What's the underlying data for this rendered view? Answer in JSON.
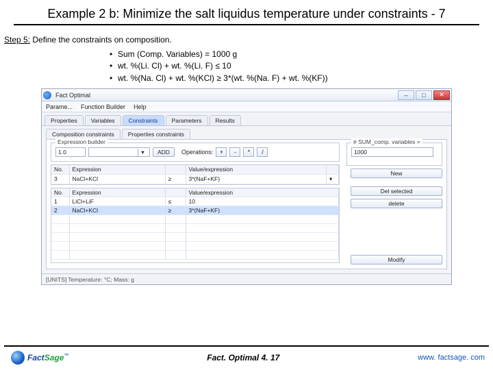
{
  "slide": {
    "title": "Example 2 b: Minimize the salt liquidus temperature under constraints - 7",
    "step_label": "Step 5:",
    "step_text": " Define the constraints on composition.",
    "bullets": [
      "Sum (Comp. Variables) = 1000 g",
      "wt. %(Li. Cl) + wt. %(Li. F) ≤ 10",
      "wt. %(Na. Cl) + wt. %(KCl) ≥ 3*(wt. %(Na. F) + wt. %(KF))"
    ]
  },
  "window": {
    "title": "Fact Optimal",
    "menus": [
      "Parame...",
      "Function Builder",
      "Help"
    ],
    "tabs": [
      "Properties",
      "Variables",
      "Constraints",
      "Parameters",
      "Results"
    ],
    "active_tab": 2,
    "subtabs": [
      "Composition constraints",
      "Properties constraints"
    ],
    "builder": {
      "legend": "Expression builder",
      "left_input": "1.0",
      "add_btn": "ADD",
      "ops_label": "Operations:",
      "ops": [
        "+",
        "-",
        "*",
        "/"
      ],
      "sum_label": "# SUM_comp. variables =",
      "sum_value": "1000"
    },
    "grid1": {
      "headers": [
        "No.",
        "Expression",
        "",
        "Value/expression",
        ""
      ],
      "rows": [
        [
          "3",
          "NaCl+KCl",
          "≥",
          "3*(NaF+KF)",
          ""
        ]
      ]
    },
    "grid2": {
      "headers": [
        "No.",
        "Expression",
        "",
        "Value/expression"
      ],
      "rows": [
        [
          "1",
          "LiCl+LiF",
          "≤",
          "10"
        ],
        [
          "2",
          "NaCl+KCl",
          "≥",
          "3*(NaF+KF)"
        ]
      ]
    },
    "buttons": {
      "new": "New",
      "del_sel": "Del selected",
      "delete": "delete",
      "modify": "Modify"
    },
    "status": "[UNITS] Temperature: °C; Mass: g"
  },
  "footer": {
    "brand_fact": "Fact",
    "brand_sage": "Sage",
    "center": "Fact. Optimal   4. 17",
    "url": "www. factsage. com"
  }
}
